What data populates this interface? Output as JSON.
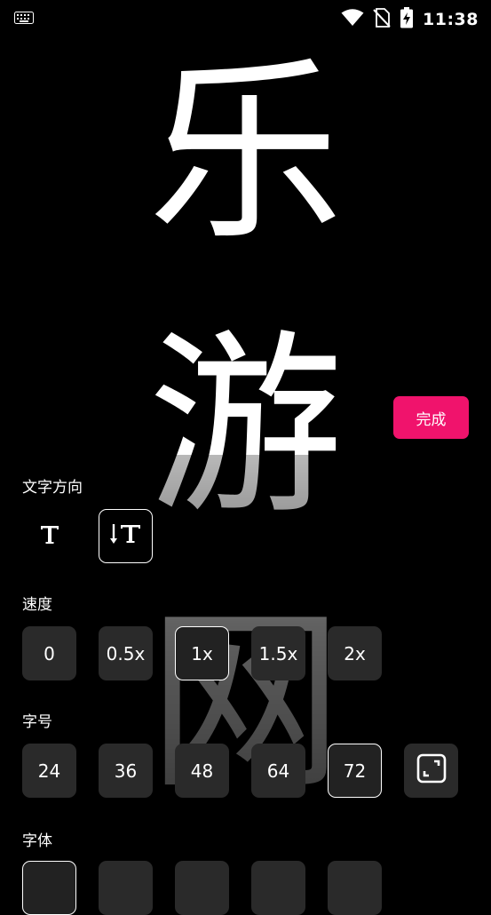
{
  "status_bar": {
    "time": "11:38"
  },
  "preview": {
    "chars": [
      "乐",
      "游",
      "网"
    ]
  },
  "done_button": {
    "label": "完成"
  },
  "direction": {
    "label": "文字方向"
  },
  "speed": {
    "label": "速度",
    "options": [
      "0",
      "0.5x",
      "1x",
      "1.5x",
      "2x"
    ],
    "selected": "1x"
  },
  "font_size": {
    "label": "字号",
    "options": [
      "24",
      "36",
      "48",
      "64",
      "72"
    ],
    "selected": "72"
  },
  "font": {
    "label": "字体"
  },
  "colors": {
    "accent": "#f0136c",
    "tile": "#2a2a2a"
  }
}
